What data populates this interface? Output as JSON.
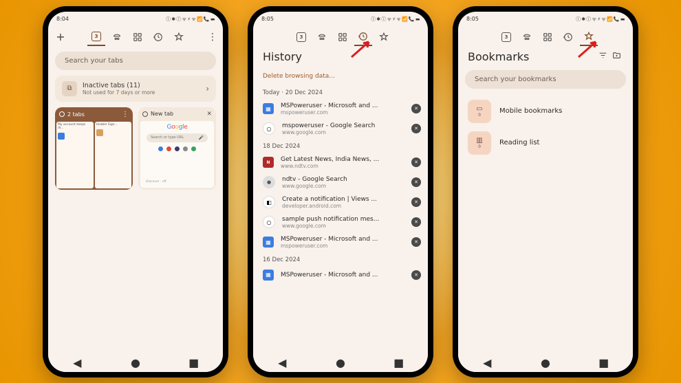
{
  "status": {
    "time1": "8:04",
    "time2": "8:05",
    "time3": "8:05",
    "net": "⬆",
    "right": "ⓘ ✱ ⓘ ᯤ ⚡ ᯤ 📶 📞 ▬"
  },
  "tabs_screen": {
    "tab_count": "3",
    "search_placeholder": "Search your tabs",
    "inactive_title": "Inactive tabs (11)",
    "inactive_sub": "Not used for 7 days or more",
    "group1_title": "2 tabs",
    "mini1_title": "My account keeps dr...",
    "mini2_title": "Unable Sign...",
    "newtab_title": "New tab",
    "goog_search": "Search or type URL",
    "goog_foot": "Discover · off"
  },
  "history_screen": {
    "title": "History",
    "delete": "Delete browsing data...",
    "sections": [
      {
        "date": "Today · 20 Dec 2024",
        "items": [
          {
            "ico": "blue",
            "glyph": "▦",
            "title": "MSPoweruser - Microsoft and ...",
            "url": "mspoweruser.com"
          },
          {
            "ico": "wht",
            "glyph": "○",
            "title": "mspoweruser - Google Search",
            "url": "www.google.com"
          }
        ]
      },
      {
        "date": "18 Dec 2024",
        "items": [
          {
            "ico": "red",
            "glyph": "N",
            "title": "Get Latest News, India News, ...",
            "url": "www.ndtv.com"
          },
          {
            "ico": "grey",
            "glyph": "●",
            "title": "ndtv - Google Search",
            "url": "www.google.com"
          },
          {
            "ico": "wht",
            "glyph": "◧",
            "title": "Create a notification  |  Views  ...",
            "url": "developer.android.com"
          },
          {
            "ico": "wht",
            "glyph": "○",
            "title": "sample push notification mes...",
            "url": "www.google.com"
          },
          {
            "ico": "blue",
            "glyph": "▦",
            "title": "MSPoweruser - Microsoft and ...",
            "url": "mspoweruser.com"
          }
        ]
      },
      {
        "date": "16 Dec 2024",
        "items": [
          {
            "ico": "blue",
            "glyph": "▦",
            "title": "MSPoweruser - Microsoft and ...",
            "url": ""
          }
        ]
      }
    ]
  },
  "bookmarks_screen": {
    "title": "Bookmarks",
    "search": "Search your bookmarks",
    "items": [
      {
        "icon": "▭",
        "label": "Mobile bookmarks",
        "count": "0"
      },
      {
        "icon": "▥",
        "label": "Reading list",
        "count": "0"
      }
    ]
  }
}
